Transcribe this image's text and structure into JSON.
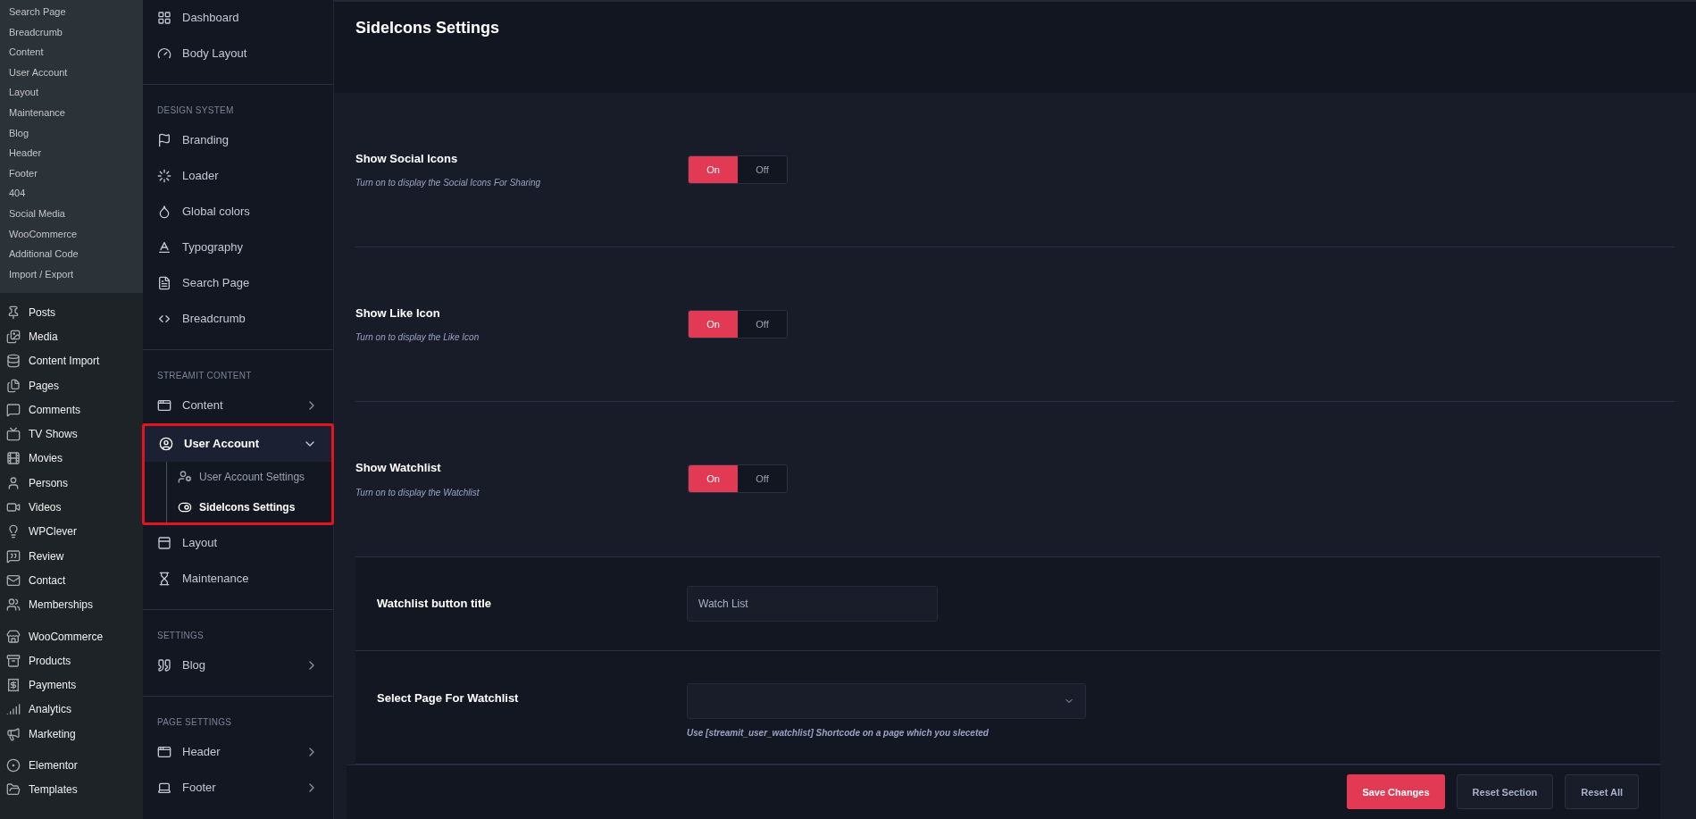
{
  "admin_submenu": [
    "Search Page",
    "Breadcrumb",
    "Content",
    "User Account",
    "Layout",
    "Maintenance",
    "Blog",
    "Header",
    "Footer",
    "404",
    "Social Media",
    "WooCommerce",
    "Additional Code",
    "Import / Export"
  ],
  "admin_menu": [
    [
      "Posts",
      "Media",
      "Content Import",
      "Pages",
      "Comments",
      "TV Shows",
      "Movies",
      "Persons",
      "Videos",
      "WPClever",
      "Review",
      "Contact",
      "Memberships"
    ],
    [
      "WooCommerce",
      "Products",
      "Payments",
      "Analytics",
      "Marketing"
    ],
    [
      "Elementor",
      "Templates"
    ]
  ],
  "options_nav": [
    {
      "items": [
        {
          "label": "Dashboard"
        },
        {
          "label": "Body Layout"
        }
      ]
    },
    {
      "heading": "DESIGN SYSTEM",
      "items": [
        {
          "label": "Branding"
        },
        {
          "label": "Loader"
        },
        {
          "label": "Global colors"
        },
        {
          "label": "Typography"
        },
        {
          "label": "Search Page"
        },
        {
          "label": "Breadcrumb"
        }
      ]
    },
    {
      "heading": "STREAMIT CONTENT",
      "items": [
        {
          "label": "Content",
          "expanded": false,
          "selected": false
        },
        {
          "label": "User Account",
          "expanded": true,
          "selected": true,
          "highlighted": true,
          "children": [
            {
              "label": "User Account Settings",
              "selected": false
            },
            {
              "label": "SideIcons Settings",
              "selected": true
            }
          ]
        },
        {
          "label": "Layout"
        },
        {
          "label": "Maintenance"
        }
      ]
    },
    {
      "heading": "SETTINGS",
      "items": [
        {
          "label": "Blog",
          "expanded": false,
          "selected": false
        }
      ]
    },
    {
      "heading": "PAGE SETTINGS",
      "items": [
        {
          "label": "Header",
          "expanded": false,
          "selected": false
        },
        {
          "label": "Footer",
          "expanded": false,
          "selected": false
        }
      ]
    }
  ],
  "page_title": "SideIcons Settings",
  "toggles": [
    {
      "label": "Show Social Icons",
      "description": "Turn on to display the Social Icons For Sharing",
      "on": true,
      "on_label": "On",
      "off_label": "Off"
    },
    {
      "label": "Show Like Icon",
      "description": "Turn on to display the Like Icon",
      "on": true,
      "on_label": "On",
      "off_label": "Off"
    },
    {
      "label": "Show Watchlist",
      "description": "Turn on to display the Watchlist",
      "on": true,
      "on_label": "On",
      "off_label": "Off"
    }
  ],
  "watchlist_options": [
    {
      "kind": "text",
      "label": "Watchlist button title",
      "value": "Watch List"
    },
    {
      "kind": "select",
      "label": "Select Page For Watchlist",
      "help": "Use [streamit_user_watchlist] Shortcode on a page which you sleceted"
    }
  ],
  "buttons": [
    {
      "label": "Save Changes",
      "primary": true
    },
    {
      "label": "Reset Section",
      "primary": false
    },
    {
      "label": "Reset All",
      "primary": false
    }
  ]
}
